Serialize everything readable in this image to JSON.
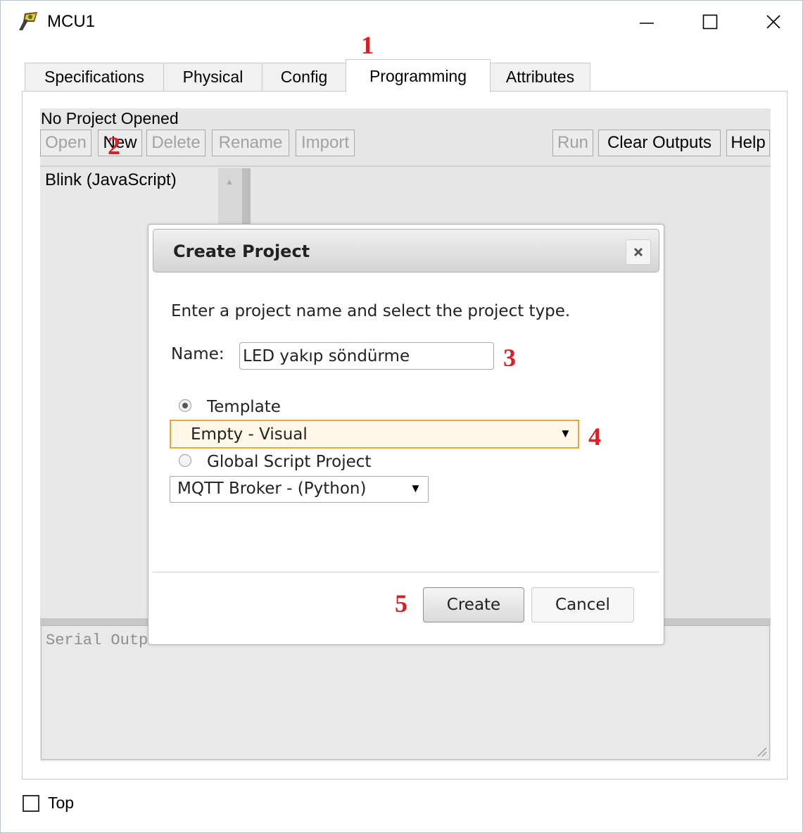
{
  "window": {
    "title": "MCU1"
  },
  "tabs": [
    {
      "label": "Specifications",
      "active": false
    },
    {
      "label": "Physical",
      "active": false
    },
    {
      "label": "Config",
      "active": false
    },
    {
      "label": "Programming",
      "active": true
    },
    {
      "label": "Attributes",
      "active": false
    }
  ],
  "programming": {
    "status": "No Project Opened",
    "toolbar": {
      "open": "Open",
      "new": "New",
      "delete": "Delete",
      "rename": "Rename",
      "import": "Import",
      "run": "Run",
      "clear_outputs": "Clear Outputs",
      "help": "Help"
    },
    "projects": [
      "Blink (JavaScript)"
    ],
    "serial_output_placeholder": "Serial Output"
  },
  "dialog": {
    "title": "Create Project",
    "instructions": "Enter a project name and select the project type.",
    "name_label": "Name:",
    "name_value": "LED yakıp söndürme",
    "template_label": "Template",
    "template_selected": true,
    "template_value": "Empty - Visual",
    "global_label": "Global Script Project",
    "global_selected": false,
    "global_value": "MQTT Broker - (Python)",
    "create_label": "Create",
    "cancel_label": "Cancel"
  },
  "annotations": {
    "a1": "1",
    "a2": "2",
    "a3": "3",
    "a4": "4",
    "a5": "5"
  },
  "footer": {
    "top_label": "Top",
    "top_checked": false
  },
  "colors": {
    "annotation": "#d92027",
    "focus_border": "#e6a939",
    "panel_bg": "#e6e6e6"
  },
  "icons": [
    "app-icon",
    "minimize-icon",
    "maximize-icon",
    "close-icon",
    "dialog-close-icon",
    "dropdown-arrow-icon",
    "resize-grip-icon"
  ]
}
